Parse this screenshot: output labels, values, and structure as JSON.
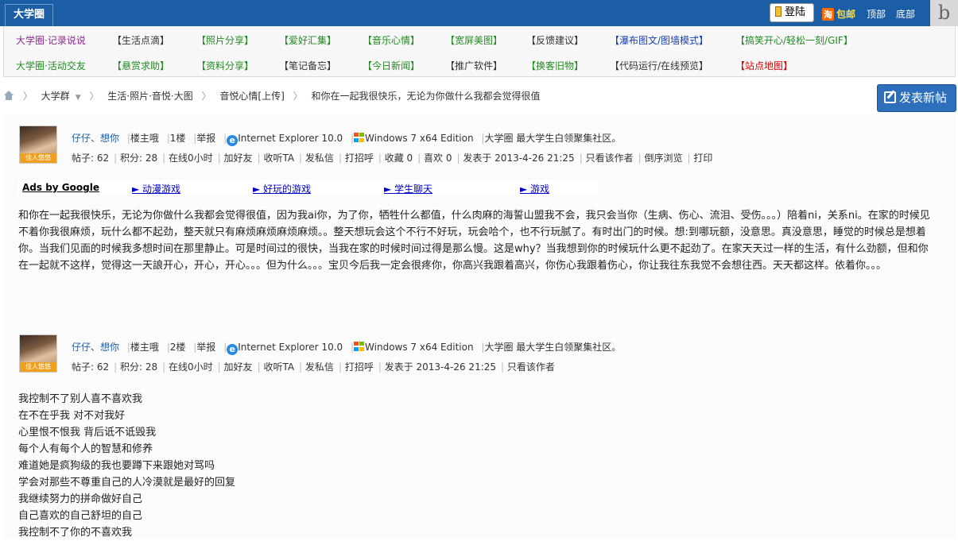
{
  "topbar": {
    "logo": "大学圈",
    "login": "登陆",
    "promo_icon": "淘",
    "promo": "包邮",
    "top": "顶部",
    "bottom": "底部",
    "corner": "b"
  },
  "nav": {
    "row1": [
      "大学圈·记录说说",
      "【生活点滴】",
      "【照片分享】",
      "【爱好汇集】",
      "【音乐心情】",
      "【宽屏美图】",
      "【反馈建议】",
      "【瀑布图文/图墙模式】",
      "【搞笑开心/轻松一刻/GIF】"
    ],
    "row2": [
      "大学圈·活动交友",
      "【悬赏求助】",
      "【资料分享】",
      "【笔记备忘】",
      "【今日新闻】",
      "【推广软件】",
      "【换客旧物】",
      "【代码运行/在线预览】",
      "【站点地图】"
    ]
  },
  "colors": {
    "purple": "#8a2b8a",
    "green": "#228b22",
    "dark": "#333333",
    "blue": "#1a3fb3",
    "red": "#dd0000",
    "accent": "#1c5ea6"
  },
  "breadcrumb": {
    "home_icon": "home-icon",
    "items": [
      "大学群",
      "生活·照片·音悦·大图",
      "音悦心情[上传]",
      "和你在一起我很快乐，无论为你做什么我都会觉得很值"
    ]
  },
  "new_post": "发表新帖",
  "posts": [
    {
      "avatar_caption": "佳人悠悠",
      "author": "仔仔、想你",
      "role": "楼主哦",
      "floor": "1楼",
      "report": "举报",
      "browser": "Internet Explorer 10.0",
      "os": "Windows 7 x64 Edition",
      "site": "大学圈 最大学生白领聚集社区。",
      "stats": [
        "帖子: 62",
        "积分: 28",
        "在线0小时",
        "加好友",
        "收听TA",
        "发私信",
        "打招呼",
        "收藏 0",
        "喜欢 0",
        "发表于 2013-4-26 21:25",
        "只看该作者",
        "倒序浏览",
        "打印"
      ]
    },
    {
      "avatar_caption": "佳人悠悠",
      "author": "仔仔、想你",
      "role": "楼主哦",
      "floor": "2楼",
      "report": "举报",
      "browser": "Internet Explorer 10.0",
      "os": "Windows 7 x64 Edition",
      "site": "大学圈 最大学生白领聚集社区。",
      "stats": [
        "帖子: 62",
        "积分: 28",
        "在线0小时",
        "加好友",
        "收听TA",
        "发私信",
        "打招呼",
        "发表于 2013-4-26 21:25",
        "只看该作者"
      ]
    }
  ],
  "ads": {
    "label": "Ads by Google",
    "links": [
      "► 动漫游戏",
      "► 好玩的游戏",
      "► 学生聊天",
      "► 游戏"
    ]
  },
  "post1_body": "和你在一起我很快乐，无论为你做什么我都会觉得很值，因为我ai你，为了你，牺牲什么都值，什么肉麻的海誓山盟我不会，我只会当你（生病、伤心、流泪、受伤。。。）陪着ni，关系ni。在家的时候见不着你我很麻烦，玩什么都不起劲，整天就只有麻烦麻烦麻烦麻烦。。整天想玩会这个不行不好玩，玩会哈个，也不行玩腻了。有时出门的时候。想:到哪玩额，没意思。真没意思，睡觉的时候总是想着你。当我们见面的时候我多想时间在那里静止。可是时间过的很快，当我在家的时候时间过得是那么慢。这是why？当我想到你的时候玩什么更不起劲了。在家天天过一样的生活，有什么劲额，但和你在一起就不这样，觉得这一天誏开心，开心，开心。。。但为什么。。。宝贝今后我一定会很疼你，你高兴我跟着高兴，你伤心我跟着伤心，你让我往东我觉不会想往西。天天都这样。依着你。。。",
  "post2_lines": [
    "我控制不了别人喜不喜欢我",
    "在不在乎我 对不对我好",
    "心里恨不恨我 背后诋不诋毁我",
    "每个人有每个人的智慧和修养",
    "难道她是疯狗级的我也要蹲下来跟她对骂吗",
    "学会对那些不尊重自己的人冷漠就是最好的回复",
    "我继续努力的拼命做好自己",
    "自己喜欢的自己舒坦的自己",
    "我控制不了你的不喜欢我"
  ]
}
